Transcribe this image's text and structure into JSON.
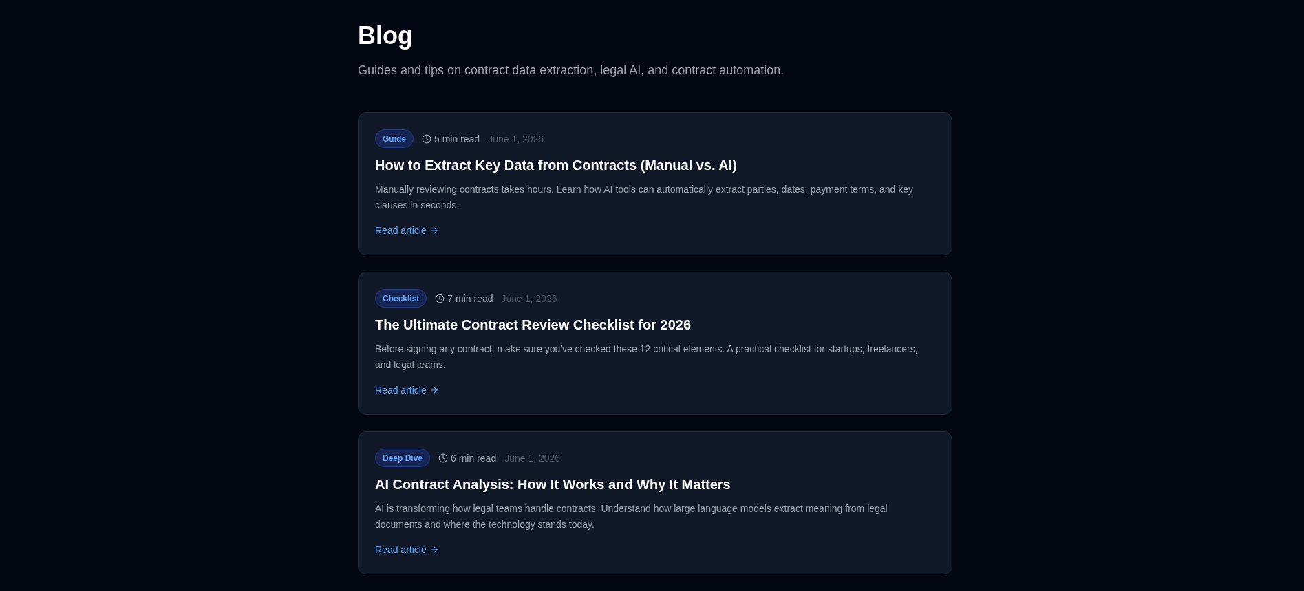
{
  "page": {
    "title": "Blog",
    "subtitle": "Guides and tips on contract data extraction, legal AI, and contract automation."
  },
  "posts": [
    {
      "tag": "Guide",
      "read_time": "5 min read",
      "date": "June 1, 2026",
      "title": "How to Extract Key Data from Contracts (Manual vs. AI)",
      "excerpt": "Manually reviewing contracts takes hours. Learn how AI tools can automatically extract parties, dates, payment terms, and key clauses in seconds.",
      "link": "Read article"
    },
    {
      "tag": "Checklist",
      "read_time": "7 min read",
      "date": "June 1, 2026",
      "title": "The Ultimate Contract Review Checklist for 2026",
      "excerpt": "Before signing any contract, make sure you've checked these 12 critical elements. A practical checklist for startups, freelancers, and legal teams.",
      "link": "Read article"
    },
    {
      "tag": "Deep Dive",
      "read_time": "6 min read",
      "date": "June 1, 2026",
      "title": "AI Contract Analysis: How It Works and Why It Matters",
      "excerpt": "AI is transforming how legal teams handle contracts. Understand how large language models extract meaning from legal documents and where the technology stands today.",
      "link": "Read article"
    }
  ]
}
